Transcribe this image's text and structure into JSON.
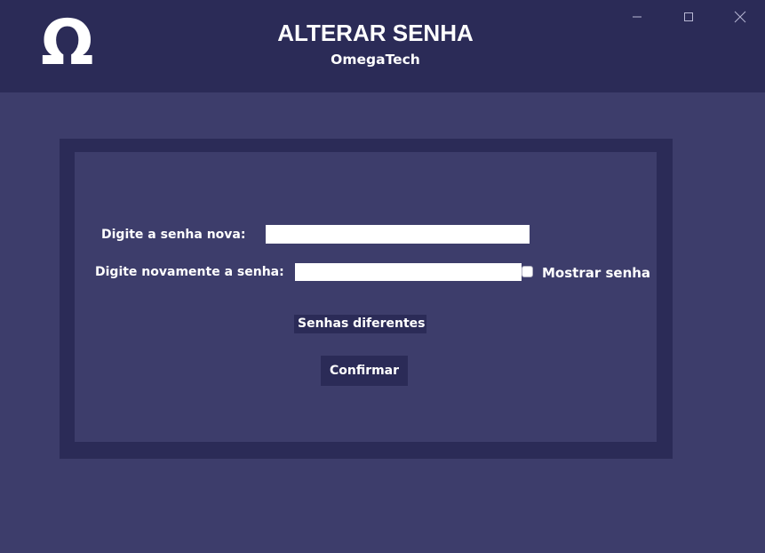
{
  "header": {
    "logo": "Ω",
    "title": "ALTERAR SENHA",
    "subtitle": "OmegaTech"
  },
  "window_controls": {
    "minimize": "minimize-icon",
    "maximize": "maximize-icon",
    "close": "close-icon"
  },
  "form": {
    "new_password_label": "Digite a senha nova:",
    "new_password_value": "",
    "repeat_password_label": "Digite novamente a senha:",
    "repeat_password_value": "",
    "show_password_label": "Mostrar senha",
    "show_password_checked": false,
    "message": "Senhas diferentes",
    "confirm_label": "Confirmar"
  },
  "colors": {
    "header_bg": "#2b2b57",
    "body_bg": "#3d3d6b",
    "panel_border": "#2b2b57",
    "text": "#ffffff"
  }
}
